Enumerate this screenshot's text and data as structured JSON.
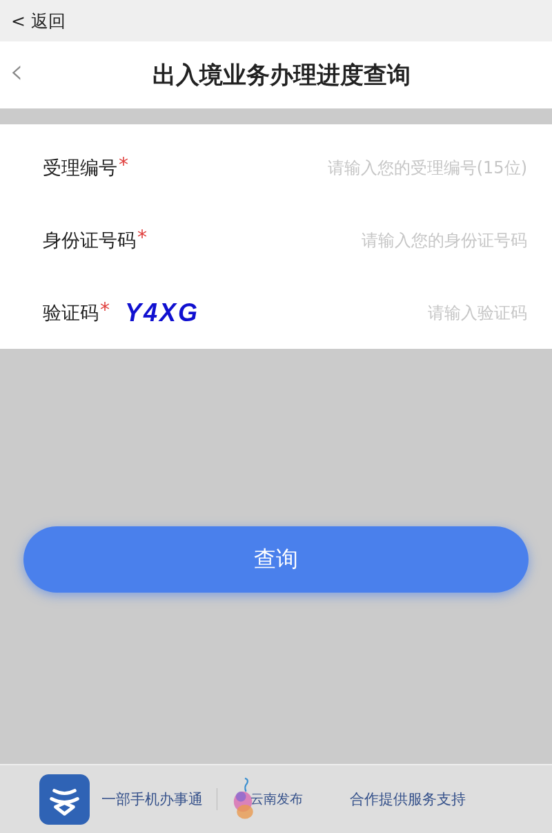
{
  "top_bar": {
    "back_label": "< 返回"
  },
  "header": {
    "back_icon": "‹",
    "title": "出入境业务办理进度查询"
  },
  "form": {
    "fields": [
      {
        "kind": "text",
        "label": "受理编号",
        "required_mark": "*",
        "placeholder": "请输入您的受理编号(15位)"
      },
      {
        "kind": "text",
        "label": "身份证号码",
        "required_mark": "*",
        "placeholder": "请输入您的身份证号码"
      },
      {
        "kind": "captcha",
        "label": "验证码",
        "required_mark": "*",
        "captcha": "Y4XG",
        "placeholder": "请输入验证码"
      }
    ]
  },
  "submit_button": "查询",
  "footer": {
    "app_name": "一部手机办事通",
    "partner_name": "云南发布",
    "support_text": "合作提供服务支持"
  }
}
